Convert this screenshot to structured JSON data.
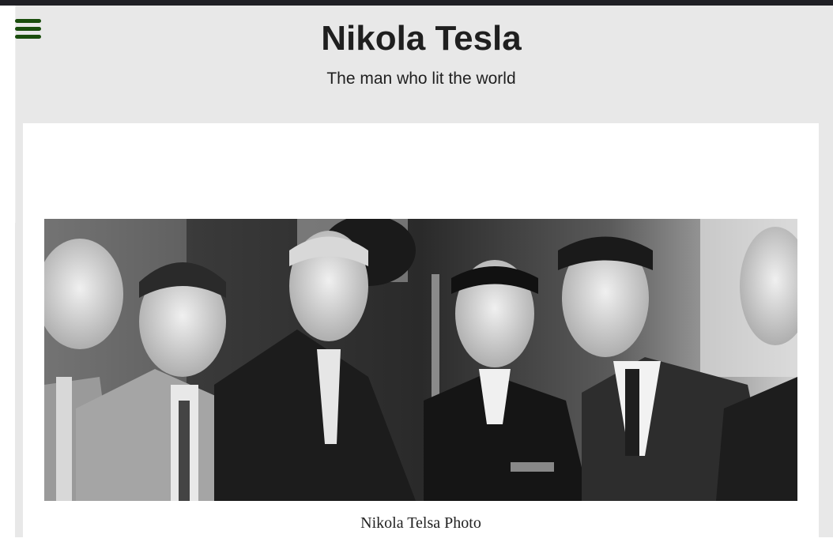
{
  "header": {
    "title": "Nikola Tesla",
    "tagline": "The man who lit the world"
  },
  "menu": {
    "icon": "hamburger-menu-icon"
  },
  "figure": {
    "caption": "Nikola Telsa Photo"
  },
  "colors": {
    "menu_icon": "#1a4d0d",
    "header_bg": "#e8e8e8",
    "card_bg": "#ffffff",
    "topbar": "#1f1f24"
  }
}
